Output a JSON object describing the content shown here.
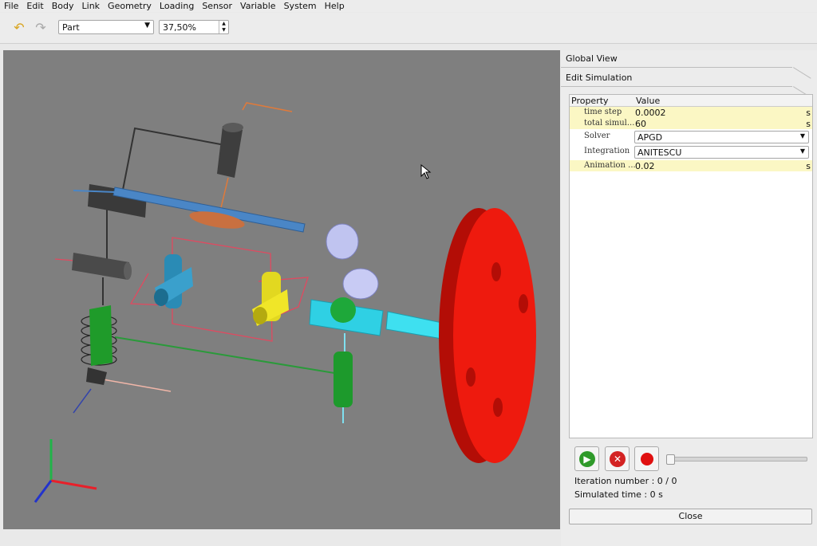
{
  "menu": {
    "items": [
      "File",
      "Edit",
      "Body",
      "Link",
      "Geometry",
      "Loading",
      "Sensor",
      "Variable",
      "System",
      "Help"
    ]
  },
  "toolbar": {
    "undo_icon": "undo-arrow-icon",
    "redo_icon": "redo-arrow-icon",
    "mode_select": "Part",
    "zoom_value": "37,50%"
  },
  "viewport": {
    "background": "#7f7f7f",
    "axes_colors": {
      "x": "#e8202a",
      "y": "#22b34a",
      "z": "#2233cc"
    },
    "disc_color": "#ee1a0e"
  },
  "panel": {
    "tab_global": "Global View",
    "tab_edit": "Edit Simulation",
    "table": {
      "col_property": "Property",
      "col_value": "Value",
      "rows": [
        {
          "name": "time step",
          "value": "0.0002",
          "unit": "s"
        },
        {
          "name": "total simul...",
          "value": "60",
          "unit": "s"
        },
        {
          "name": "Solver",
          "value": "APGD"
        },
        {
          "name": "Integration",
          "value": "ANITESCU"
        },
        {
          "name": "Animation ...",
          "value": "0.02",
          "unit": "s"
        }
      ]
    },
    "play_icon": "play-icon",
    "stop_icon": "stop-x-icon",
    "record_icon": "record-icon",
    "iteration_text": "Iteration number : 0 / 0",
    "simulated_text": "Simulated time : 0 s",
    "close_label": "Close"
  }
}
